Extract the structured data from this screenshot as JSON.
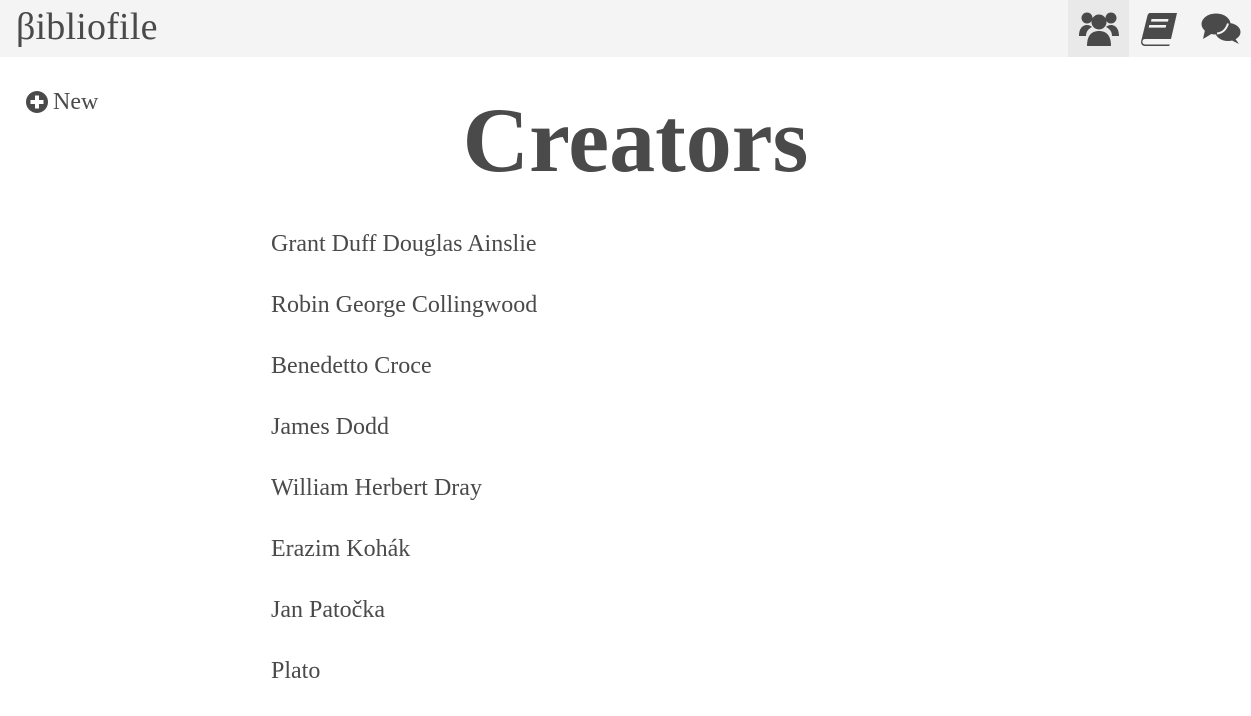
{
  "app": {
    "brand": "βibliofile"
  },
  "nav": {
    "items": [
      {
        "icon": "users-icon",
        "active": true
      },
      {
        "icon": "book-icon",
        "active": false
      },
      {
        "icon": "comments-icon",
        "active": false
      }
    ]
  },
  "sidebar": {
    "new_label": "New"
  },
  "main": {
    "title": "Creators",
    "creators": [
      "Grant Duff Douglas Ainslie",
      "Robin George Collingwood",
      "Benedetto Croce",
      "James Dodd",
      "William Herbert Dray",
      "Erazim Kohák",
      "Jan Patočka",
      "Plato"
    ]
  },
  "colors": {
    "text": "#4a4a4a",
    "topbar_bg": "#f4f4f4",
    "active_nav_bg": "#e9e9e9"
  }
}
